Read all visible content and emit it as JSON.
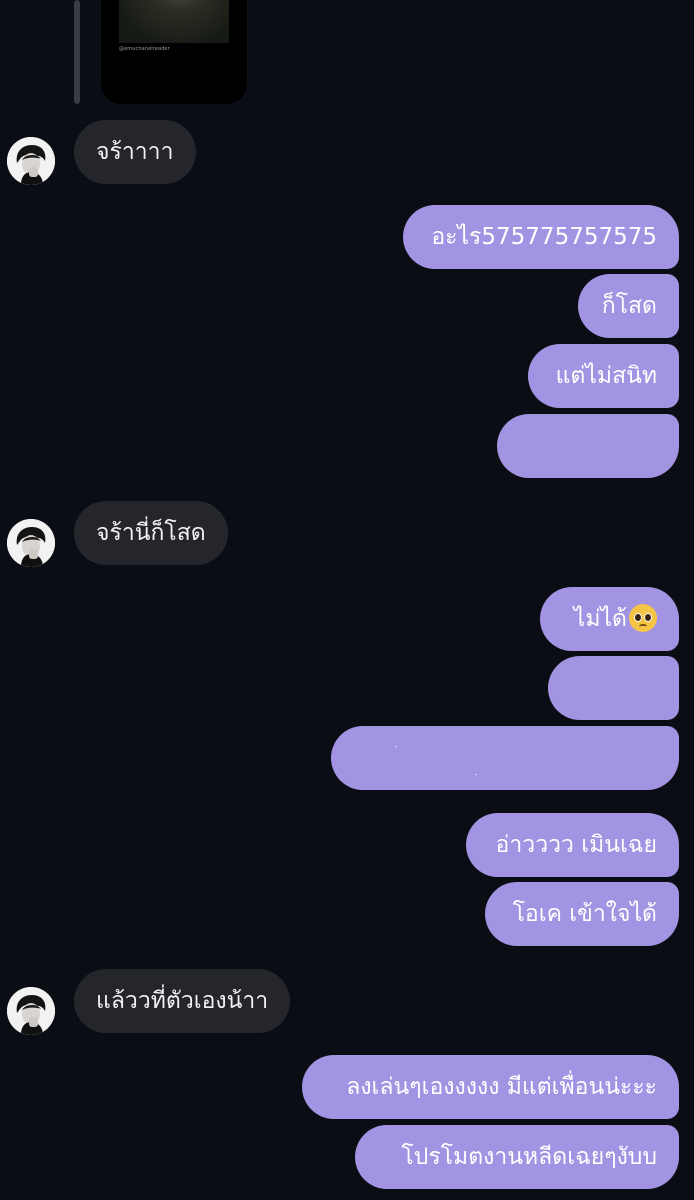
{
  "media_preview": {
    "caption": "@emuchanelreader"
  },
  "messages": [
    {
      "direction": "incoming",
      "text": "จร้าาาา"
    },
    {
      "direction": "outgoing",
      "text": "อะไร575775757575"
    },
    {
      "direction": "outgoing",
      "text": "ก็โสด"
    },
    {
      "direction": "outgoing",
      "text": "แต่ไม่สนิท"
    },
    {
      "direction": "outgoing",
      "text": "",
      "redacted": true
    },
    {
      "direction": "incoming",
      "text": "จร้านี่ก็โสด"
    },
    {
      "direction": "outgoing",
      "text": "ไม่ได้",
      "emoji": "pleading-face"
    },
    {
      "direction": "outgoing",
      "text": "",
      "redacted": true
    },
    {
      "direction": "outgoing",
      "text": "",
      "redacted": true
    },
    {
      "direction": "outgoing",
      "text": "อ่าวววว เมินเฉย"
    },
    {
      "direction": "outgoing",
      "text": "โอเค เข้าใจได้"
    },
    {
      "direction": "incoming",
      "text": "แล้ววที่ตัวเองน้าา"
    },
    {
      "direction": "outgoing",
      "text": "ลงเล่นๆเองงงงง มีแต่เพื่อนน่ะะะ"
    },
    {
      "direction": "outgoing",
      "text": "โปรโมตงานหลีดเฉยๆงับบ"
    }
  ],
  "colors": {
    "background": "#0b0d14",
    "incoming_bubble": "#25262c",
    "outgoing_bubble": "#a294e2"
  }
}
